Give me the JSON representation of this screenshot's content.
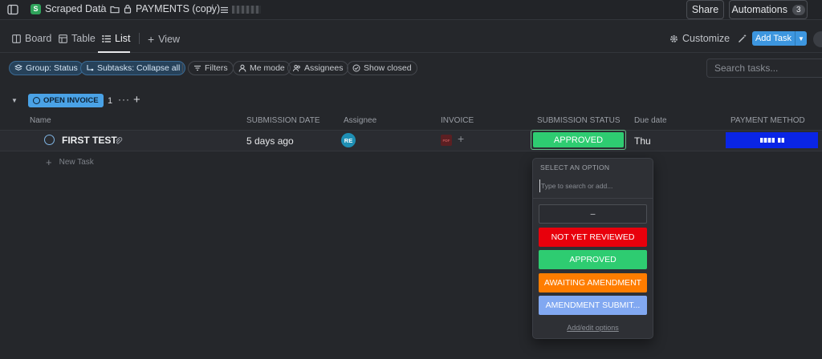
{
  "breadcrumb": {
    "space": {
      "badge": "S",
      "label": "Scraped Data"
    },
    "folder": {
      "label": "PAYMENTS (copy)"
    },
    "separator": "/"
  },
  "header": {
    "share_label": "Share",
    "automations_label": "Automations",
    "automations_count": "3"
  },
  "views": {
    "tabs": [
      {
        "label": "Board",
        "icon": "board-icon"
      },
      {
        "label": "Table",
        "icon": "table-icon"
      },
      {
        "label": "List",
        "icon": "list-icon",
        "active": true
      }
    ],
    "add_view_label": "View",
    "customize_label": "Customize",
    "add_task_label": "Add Task"
  },
  "filters": {
    "chips": [
      {
        "label": "Group: Status",
        "highlighted": true
      },
      {
        "label": "Subtasks: Collapse all",
        "highlighted": true
      },
      {
        "label": "Filters"
      },
      {
        "label": "Me mode"
      },
      {
        "label": "Assignees"
      },
      {
        "label": "Show closed"
      }
    ],
    "search_placeholder": "Search tasks..."
  },
  "group": {
    "status_label": "OPEN INVOICE",
    "status_color": "#4aa2e6",
    "count": "1",
    "more": "···",
    "add": "+"
  },
  "columns": [
    "Name",
    "SUBMISSION DATE",
    "Assignee",
    "INVOICE",
    "SUBMISSION STATUS",
    "Due date",
    "PAYMENT METHOD"
  ],
  "task": {
    "name": "FIRST TEST",
    "submission_date": "5 days ago",
    "assignee_initials": "RE",
    "invoice_file_type": "PDF",
    "submission_status": "APPROVED",
    "due_date": "Thu",
    "payment_method_color": "#0a25e6"
  },
  "new_task_label": "New Task",
  "dropdown": {
    "title": "SELECT AN OPTION",
    "search_placeholder": "Type to search or add...",
    "options": [
      {
        "label": "–",
        "color": ""
      },
      {
        "label": "NOT YET REVIEWED",
        "color": "#e8000c"
      },
      {
        "label": "APPROVED",
        "color": "#2ecc71"
      },
      {
        "label": "AWAITING AMENDMENT",
        "color": "#ff7d00"
      },
      {
        "label": "AMENDMENT SUBMIT...",
        "color": "#81a8f1"
      }
    ],
    "footer_link": "Add/edit options"
  }
}
